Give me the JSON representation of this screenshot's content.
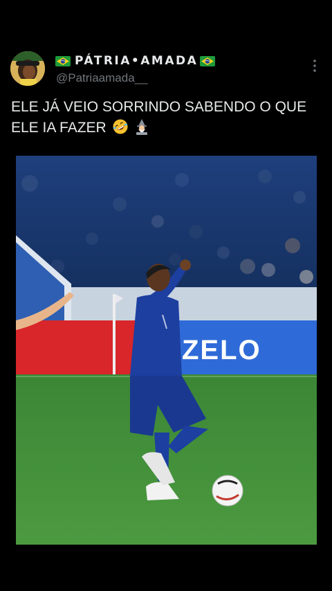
{
  "post": {
    "display_name": "PÁTRIA•AMADA",
    "handle": "@Patriaamada__",
    "text": "ELE JÁ VEIO SORRINDO SABENDO O QUE ELE IA FAZER",
    "emojis": [
      "rolling-on-floor-laughing-emoji",
      "wizard-emoji"
    ]
  },
  "media": {
    "board_text": "ZELO"
  },
  "colors": {
    "background": "#000000",
    "text": "#e7e9ea",
    "secondary_text": "#71767b",
    "kit_blue": "#1d3fa0",
    "pitch_green": "#3f8a3a",
    "board_red": "#d8262a"
  },
  "icons": [
    "more-options-icon",
    "brazil-flag-icon"
  ]
}
